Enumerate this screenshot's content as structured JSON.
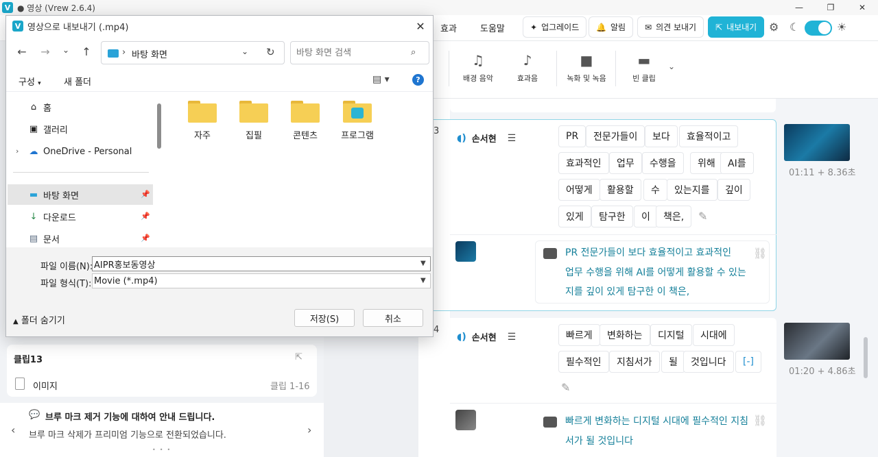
{
  "app": {
    "title": "● 영상 (Vrew 2.6.4)",
    "logo": "V",
    "window_buttons": [
      "—",
      "❐",
      "✕"
    ]
  },
  "toolbar": {
    "menu_effects": "효과",
    "menu_help": "도움말",
    "upgrade": "업그레이드",
    "alarm": "알림",
    "feedback": "의견 보내기",
    "export": "내보내기",
    "accent_color": "#20b3d6"
  },
  "ribbon": {
    "items": [
      {
        "label": "배경 음악",
        "icon": "music-icon"
      },
      {
        "label": "효과음",
        "icon": "bell-icon"
      },
      {
        "label": "녹화 및 녹음",
        "icon": "camera-icon"
      },
      {
        "label": "빈 클립",
        "icon": "empty-clip-icon"
      }
    ]
  },
  "left_panel": {
    "clip_title": "클립13",
    "clip_item_label": "이미지",
    "clip_item_range": "클립 1-16",
    "notice_title": "브루 마크 제거 기능에 대하여 안내 드립니다.",
    "notice_body": "브루 마크 삭제가 프리미엄 기능으로 전환되었습니다."
  },
  "editor": {
    "clips": [
      {
        "number": "3",
        "speaker": "손서현",
        "words": [
          "PR",
          "전문가들이",
          "보다",
          "효율적이고",
          "효과적인",
          "업무",
          "수행을",
          "위해",
          "AI를",
          "어떻게",
          "활용할",
          "수",
          "있는지를",
          "깊이",
          "있게",
          "탐구한",
          "이",
          "책은,"
        ],
        "time": "01:11 + 8.36초",
        "text_lines": [
          "PR 전문가들이 보다 효율적이고 효과적인",
          "업무 수행을 위해 AI를 어떻게 활용할 수 있는",
          "지를 깊이 있게 탐구한 이 책은,"
        ]
      },
      {
        "number": "4",
        "speaker": "손서현",
        "words": [
          "빠르게",
          "변화하는",
          "디지털",
          "시대에",
          "필수적인",
          "지침서가",
          "될",
          "것입니다",
          "[-]"
        ],
        "time": "01:20 + 4.86초",
        "text_lines": [
          "빠르게 변화하는 디지털 시대에 필수적인 지침",
          "서가 될 것입니다"
        ]
      }
    ]
  },
  "dialog": {
    "title": "영상으로 내보내기 (.mp4)",
    "address": "바탕 화면",
    "search_placeholder": "바탕 화면 검색",
    "organize": "구성",
    "new_folder": "새 폴더",
    "help": "?",
    "nav_items": [
      {
        "label": "홈",
        "icon": "home-icon"
      },
      {
        "label": "갤러리",
        "icon": "gallery-icon"
      },
      {
        "label": "OneDrive - Personal",
        "icon": "cloud-icon"
      },
      {
        "label": "바탕 화면",
        "icon": "desktop-icon"
      },
      {
        "label": "다운로드",
        "icon": "download-icon"
      },
      {
        "label": "문서",
        "icon": "document-icon"
      }
    ],
    "folders": [
      "자주",
      "집필",
      "콘텐츠",
      "프로그램"
    ],
    "filename_label": "파일 이름(N):",
    "filename_value": "AIPR홍보동영상",
    "filetype_label": "파일 형식(T):",
    "filetype_value": "Movie (*.mp4)",
    "hide_folders": "폴더 숨기기",
    "save": "저장(S)",
    "cancel": "취소"
  }
}
